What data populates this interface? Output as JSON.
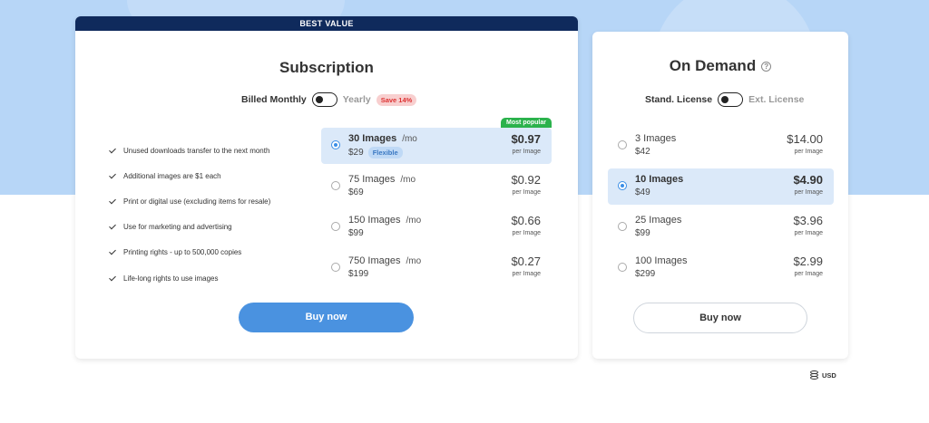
{
  "subscription": {
    "banner": "BEST VALUE",
    "title": "Subscription",
    "billing": {
      "monthly_label": "Billed Monthly",
      "yearly_label": "Yearly",
      "save_badge": "Save 14%"
    },
    "features": [
      "Unused downloads transfer to the next month",
      "Additional images are $1 each",
      "Print or digital use (excluding items for resale)",
      "Use for marketing and advertising",
      "Printing rights - up to 500,000 copies",
      "Life-long rights to use images"
    ],
    "plans": [
      {
        "name": "30 Images",
        "period": "/mo",
        "total": "$29",
        "tag": "Flexible",
        "price": "$0.97",
        "per_label": "per Image",
        "badge": "Most popular",
        "selected": true
      },
      {
        "name": "75 Images",
        "period": "/mo",
        "total": "$69",
        "price": "$0.92",
        "per_label": "per Image",
        "selected": false
      },
      {
        "name": "150 Images",
        "period": "/mo",
        "total": "$99",
        "price": "$0.66",
        "per_label": "per Image",
        "selected": false
      },
      {
        "name": "750 Images",
        "period": "/mo",
        "total": "$199",
        "price": "$0.27",
        "per_label": "per Image",
        "selected": false
      }
    ],
    "buy_label": "Buy now"
  },
  "on_demand": {
    "title": "On Demand",
    "help_glyph": "?",
    "license": {
      "standard_label": "Stand. License",
      "extended_label": "Ext. License"
    },
    "plans": [
      {
        "name": "3 Images",
        "total": "$42",
        "price": "$14.00",
        "per_label": "per Image",
        "selected": false
      },
      {
        "name": "10 Images",
        "total": "$49",
        "price": "$4.90",
        "per_label": "per Image",
        "selected": true
      },
      {
        "name": "25 Images",
        "total": "$99",
        "price": "$3.96",
        "per_label": "per Image",
        "selected": false
      },
      {
        "name": "100 Images",
        "total": "$299",
        "price": "$2.99",
        "per_label": "per Image",
        "selected": false
      }
    ],
    "buy_label": "Buy now"
  },
  "currency": {
    "label": "USD"
  },
  "colors": {
    "banner": "#0f2a5c",
    "primary_button": "#4a92e0",
    "selected_row": "#dbe9f9",
    "popular_badge": "#2bb24c",
    "save_badge": "#f8cfcf",
    "background_band": "#b7d6f7"
  }
}
